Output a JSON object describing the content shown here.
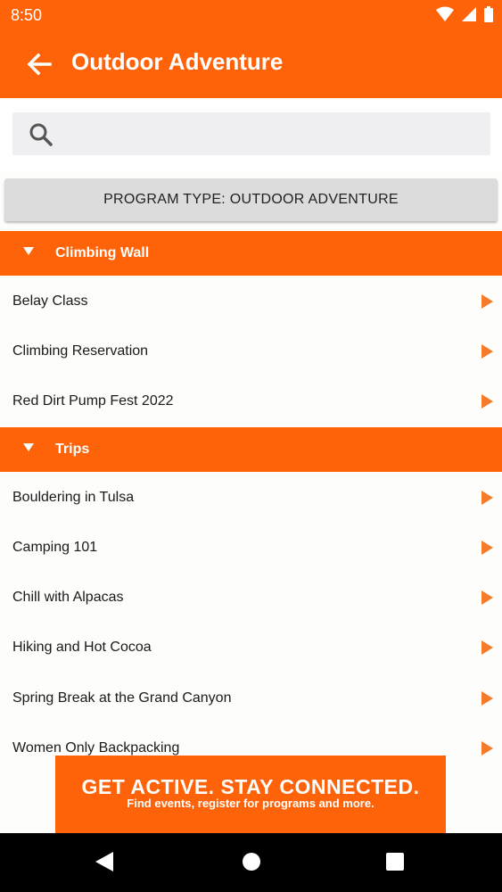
{
  "status_bar": {
    "time": "8:50",
    "icons": [
      "wifi-icon",
      "signal-icon",
      "battery-icon"
    ]
  },
  "app_bar": {
    "title": "Outdoor Adventure",
    "back_icon": "arrow-left-icon"
  },
  "search": {
    "placeholder": "",
    "value": "",
    "icon": "search-icon"
  },
  "program_type_button": {
    "label": "PROGRAM TYPE: OUTDOOR ADVENTURE"
  },
  "sections": [
    {
      "label": "Climbing Wall",
      "items": [
        "Belay Class",
        "Climbing Reservation",
        "Red Dirt Pump Fest 2022"
      ]
    },
    {
      "label": "Trips",
      "items": [
        "Bouldering in Tulsa",
        "Camping 101",
        "Chill with Alpacas",
        "Hiking and Hot Cocoa",
        "Spring Break at the Grand Canyon",
        "Women Only Backpacking"
      ]
    }
  ],
  "banner": {
    "headline": "GET ACTIVE.  STAY CONNECTED.",
    "subtext": "Find events, register for programs and more."
  },
  "nav_bar": {
    "icons": [
      "back-triangle-icon",
      "home-circle-icon",
      "recents-square-icon"
    ]
  },
  "colors": {
    "accent": "#ff6309",
    "row_arrow": "#f47b2a",
    "search_bg": "#efeff1",
    "button_bg": "#dcdcdc"
  }
}
